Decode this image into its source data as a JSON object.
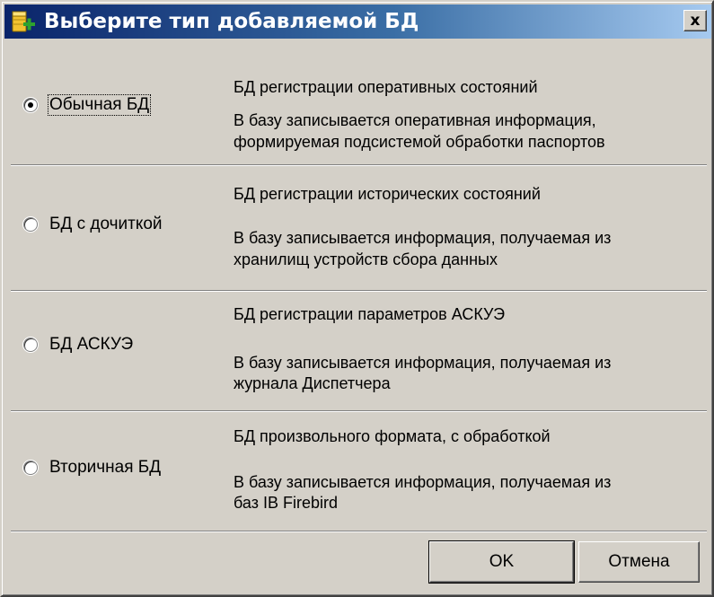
{
  "window": {
    "title": "Выберите тип добавляемой БД",
    "close_label": "x"
  },
  "options": [
    {
      "label": "Обычная БД",
      "title": "БД регистрации оперативных состояний",
      "desc_line1": "В базу записывается оперативная информация,",
      "desc_line2": "формируемая подсистемой обработки паспортов",
      "checked": true
    },
    {
      "label": "БД с дочиткой",
      "title": "БД регистрации исторических состояний",
      "desc_line1": "В базу записывается информация, получаемая из",
      "desc_line2": "хранилищ устройств сбора данных",
      "checked": false
    },
    {
      "label": "БД АСКУЭ",
      "title": "БД регистрации параметров АСКУЭ",
      "desc_line1": "В базу записывается информация, получаемая из",
      "desc_line2": "журнала Диспетчера",
      "checked": false
    },
    {
      "label": "Вторичная БД",
      "title": "БД произвольного формата, с обработкой",
      "desc_line1": "В базу записывается информация, получаемая из",
      "desc_line2": "баз IB Firebird",
      "checked": false
    }
  ],
  "buttons": {
    "ok_label": "OK",
    "cancel_label": "Отмена"
  },
  "icons": {
    "app": "database-add-icon",
    "close": "close-icon"
  },
  "colors": {
    "title_bar_start": "#0a246a",
    "title_bar_end": "#a6caf0",
    "face": "#d4d0c8"
  }
}
